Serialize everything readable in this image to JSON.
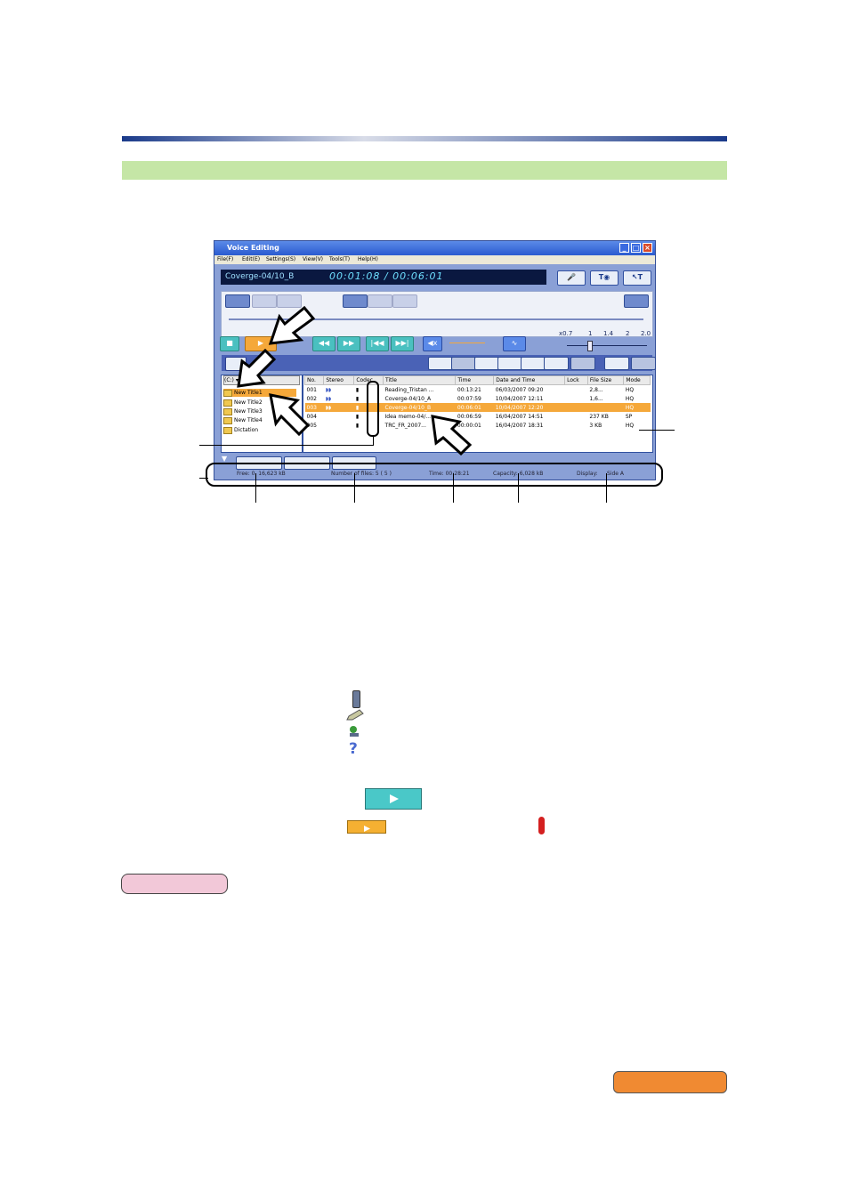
{
  "app": {
    "title": "Voice Editing",
    "menu": [
      "File(F)",
      "Edit(E)",
      "Settings(S)",
      "View(V)",
      "Tools(T)",
      "Help(H)"
    ],
    "current_file": "Coverge-04/10_B",
    "elapsed": "00:01:08",
    "separator": "/",
    "total": "00:06:01",
    "speed_labels": [
      "x0.7",
      "1",
      "1.4",
      "2",
      "2.0"
    ],
    "drive": "(C:)",
    "folders": [
      "New Title1",
      "New Title2",
      "New Title3",
      "New Title4",
      "Dictation"
    ],
    "columns": [
      "No.",
      "Stereo",
      "Codec",
      "Title",
      "Time",
      "Date and Time",
      "Lock",
      "File Size",
      "Mode"
    ],
    "rows": [
      {
        "no": "001",
        "stereo": "◗◗",
        "title": "Reading_Tristan ...",
        "time": "00:13:21",
        "date": "06/03/2007 09:20",
        "size": "2,8...",
        "mode": "HQ"
      },
      {
        "no": "002",
        "stereo": "◗◗",
        "title": "Coverge-04/10_A",
        "time": "00:07:59",
        "date": "10/04/2007 12:11",
        "size": "1,6...",
        "mode": "HQ"
      },
      {
        "no": "003",
        "stereo": "◗◗",
        "title": "Coverge-04/10_B",
        "time": "00:06:01",
        "date": "10/04/2007 12:20",
        "size": "",
        "mode": "HQ"
      },
      {
        "no": "004",
        "stereo": "",
        "title": "Idea memo-04/...",
        "time": "00:06:59",
        "date": "16/04/2007 14:51",
        "size": "237 KB",
        "mode": "SP"
      },
      {
        "no": "005",
        "stereo": "",
        "title": "TRC_FR_2007...",
        "time": "00:00:01",
        "date": "16/04/2007 18:31",
        "size": "3 KB",
        "mode": "HQ"
      }
    ],
    "status": {
      "free": "Free: 0, 16,623 kB",
      "number_of_files": "Number of files: 5 ( 5 )",
      "time": "Time: 00:28:21",
      "capacity": "Capacity: 6,028 kB",
      "display": "Display:",
      "side": "Side A"
    }
  },
  "colors": {
    "accent_teal": "#4ac0c0",
    "accent_orange": "#f5a83a",
    "title_blue": "#2a5bd0"
  }
}
